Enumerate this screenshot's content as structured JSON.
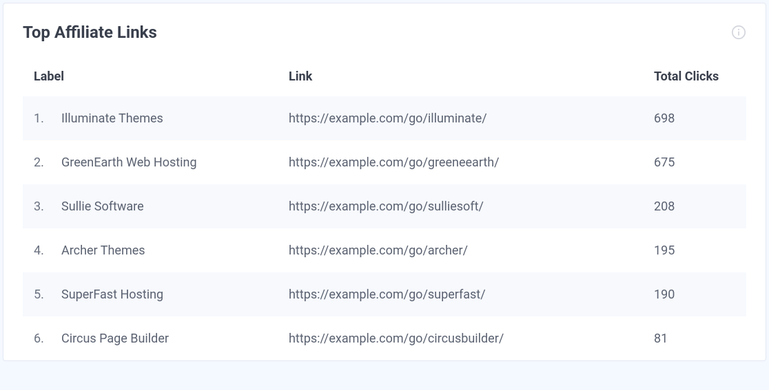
{
  "card": {
    "title": "Top Affiliate Links",
    "columns": {
      "label": "Label",
      "link": "Link",
      "clicks": "Total Clicks"
    },
    "rows": [
      {
        "rank": "1.",
        "label": "Illuminate Themes",
        "link": "https://example.com/go/illuminate/",
        "clicks": "698"
      },
      {
        "rank": "2.",
        "label": "GreenEarth Web Hosting",
        "link": "https://example.com/go/greeneearth/",
        "clicks": "675"
      },
      {
        "rank": "3.",
        "label": "Sullie Software",
        "link": "https://example.com/go/sulliesoft/",
        "clicks": "208"
      },
      {
        "rank": "4.",
        "label": "Archer Themes",
        "link": "https://example.com/go/archer/",
        "clicks": "195"
      },
      {
        "rank": "5.",
        "label": "SuperFast Hosting",
        "link": "https://example.com/go/superfast/",
        "clicks": "190"
      },
      {
        "rank": "6.",
        "label": "Circus Page Builder",
        "link": "https://example.com/go/circusbuilder/",
        "clicks": "81"
      }
    ]
  }
}
